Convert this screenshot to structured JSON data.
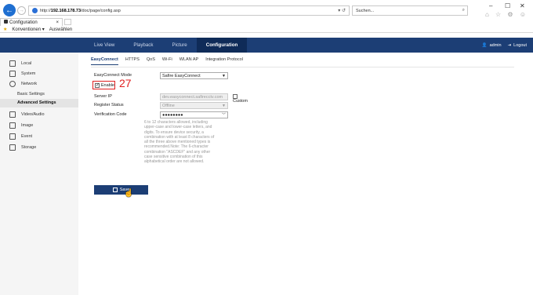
{
  "browser": {
    "url_prefix": "http://",
    "url_host": "192.168.178.73",
    "url_path": "/doc/page/config.asp",
    "address_controls": "▾ ↺",
    "search_placeholder": "Suchen...",
    "tab_title": "Configuration",
    "tab_close": "×",
    "favorites": [
      "Konventionen",
      "Auswählen"
    ],
    "window_controls": [
      "–",
      "☐",
      "✕"
    ],
    "toolbar_icons": "⌂ ☆ ⚙ ☺"
  },
  "header": {
    "tabs": [
      "Live View",
      "Playback",
      "Picture",
      "Configuration"
    ],
    "active_tab": "Configuration",
    "user": "admin",
    "logout": "Logout"
  },
  "sidebar": {
    "items": [
      "Local",
      "System",
      "Network",
      "Video/Audio",
      "Image",
      "Event",
      "Storage"
    ],
    "network_sub": [
      "Basic Settings",
      "Advanced Settings"
    ],
    "active": "Advanced Settings"
  },
  "content": {
    "sub_tabs": [
      "EasyConnect",
      "HTTPS",
      "QoS",
      "Wi-Fi",
      "WLAN AP",
      "Integration Protocol"
    ],
    "active_sub_tab": "EasyConnect",
    "form": {
      "mode_label": "EasyConnect Mode",
      "mode_value": "Safire EasyConnect",
      "enable_label": "Enable",
      "enable_checked": true,
      "server_ip_label": "Server IP",
      "server_ip_value": "dev.easyconnect.safirecctv.com",
      "custom_label": "Custom",
      "register_status_label": "Register Status",
      "register_status_value": "Offline",
      "verification_label": "Verification Code",
      "verification_value": "●●●●●●●●",
      "help_text": "6 to 12 characters allowed, including upper-case and lower-case letters, and digits. To ensure device security, a combination with at least 8 characters of all the three above mentioned types is recommended.Note: The 6-character combination \"ASCDEF\" and any other case sensitive combination of this alphabetical order are not allowed."
    },
    "annotation": "27",
    "save_label": "Save"
  },
  "colors": {
    "header_bg": "#1c3e75",
    "active_tab_bg": "#0f2b58",
    "annotation": "#e02020"
  }
}
